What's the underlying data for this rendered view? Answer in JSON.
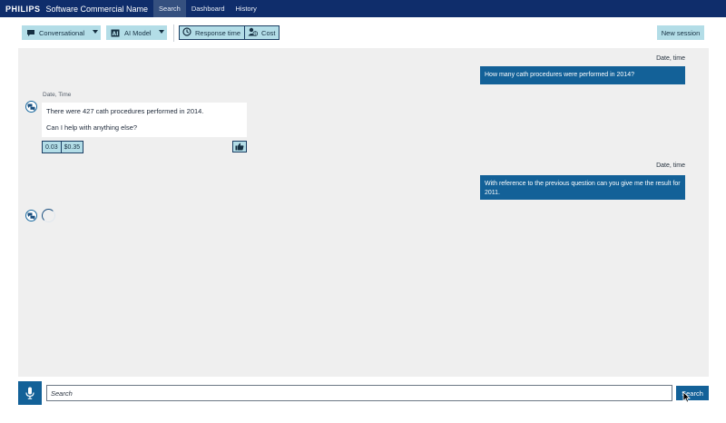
{
  "header": {
    "brand": "PHILIPS",
    "product": "Software Commercial Name",
    "tabs": [
      {
        "label": "Search",
        "active": true
      },
      {
        "label": "Dashboard",
        "active": false
      },
      {
        "label": "History",
        "active": false
      }
    ]
  },
  "toolbar": {
    "mode_label": "Conversational",
    "model_label": "AI Model",
    "response_time_label": "Response time",
    "cost_label": "Cost",
    "new_session_label": "New session",
    "icons": {
      "mode": "chat-bubble-icon",
      "model": "ai-chip-icon",
      "response_time": "clock-icon",
      "cost": "user-dollar-icon"
    }
  },
  "conversation": [
    {
      "role": "user",
      "meta": "Date, time",
      "text": "How many cath procedures were performed in 2014?"
    },
    {
      "role": "assistant",
      "meta": "Date, Time",
      "lines": [
        "There were 427 cath procedures performed in 2014.",
        "Can I help with anything else?"
      ],
      "response_time": "0.03",
      "cost": "$0.35",
      "feedback_icon": "thumbs-up-icon"
    },
    {
      "role": "user",
      "meta": "Date, time",
      "text": "With reference to the previous question can you give me the result for 2011."
    },
    {
      "role": "assistant",
      "state": "loading"
    }
  ],
  "search": {
    "placeholder": "Search",
    "button_label": "Search",
    "mic_icon": "microphone-icon"
  },
  "colors": {
    "nav_bg": "#0f2d6b",
    "accent": "#136198",
    "button_bg": "#b3dde7",
    "chat_bg": "#efefef"
  }
}
